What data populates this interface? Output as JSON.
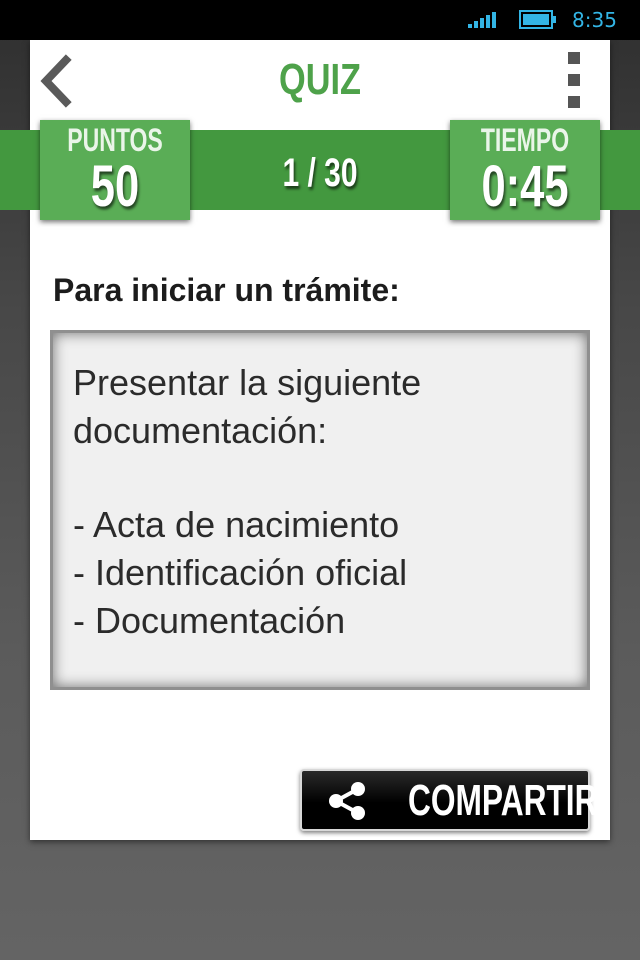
{
  "status_bar": {
    "time": "8:35",
    "signal_icon": "signal-icon",
    "battery_icon": "battery-icon",
    "accent_color": "#33b5e5"
  },
  "header": {
    "title": "QUIZ",
    "back_icon": "chevron-left-icon",
    "menu_icon": "overflow-menu-icon",
    "title_color": "#4ea24a"
  },
  "score": {
    "label": "PUNTOS",
    "value": "50"
  },
  "progress": {
    "text": "1 / 30"
  },
  "timer": {
    "label": "TIEMPO",
    "value": "0:45"
  },
  "question": {
    "text": "Para iniciar un trámite:"
  },
  "answer": {
    "lines": [
      "Presentar la siguiente",
      "documentación:",
      "",
      "- Acta de nacimiento",
      "- Identificación oficial",
      "- Documentación"
    ]
  },
  "share": {
    "label": "COMPARTIR",
    "icon": "share-icon"
  },
  "colors": {
    "band": "#43983f",
    "box": "#5aad56"
  }
}
